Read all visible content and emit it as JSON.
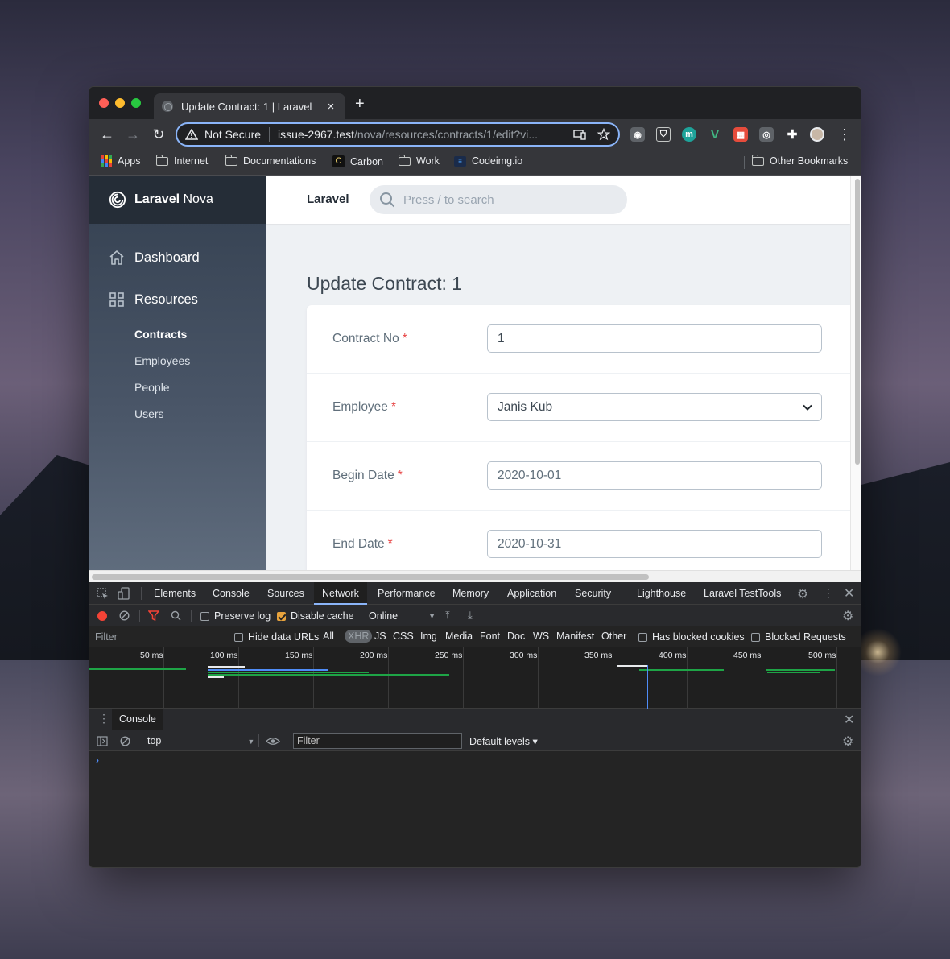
{
  "browser": {
    "tab_title": "Update Contract: 1 | Laravel",
    "tab_close": "×",
    "new_tab": "+",
    "security_label": "Not Secure",
    "url_host": "issue-2967.test",
    "url_path": "/nova/resources/contracts/1/edit?vi...",
    "nav": {
      "back": "←",
      "forward": "→",
      "reload": "↻",
      "menu": "⋮"
    },
    "bookmarks": [
      {
        "label": "Apps",
        "icon": "apps-grid-icon"
      },
      {
        "label": "Internet",
        "icon": "folder-icon"
      },
      {
        "label": "Documentations",
        "icon": "folder-icon"
      },
      {
        "label": "Carbon",
        "icon": "carbon-icon"
      },
      {
        "label": "Work",
        "icon": "folder-icon"
      },
      {
        "label": "Codeimg.io",
        "icon": "codeimg-icon"
      }
    ],
    "other_bookmarks": "Other Bookmarks",
    "extensions": [
      {
        "icon": "camera-icon",
        "glyph": "◉",
        "color": "#5f6368"
      },
      {
        "icon": "shield-icon",
        "glyph": "⛉",
        "color": "#35363a"
      },
      {
        "icon": "m-icon",
        "glyph": "m",
        "color": "#1ea39a"
      },
      {
        "icon": "vue-icon",
        "glyph": "V",
        "color": "#35363a"
      },
      {
        "icon": "laravel-icon",
        "glyph": "▦",
        "color": "#e64c3c"
      },
      {
        "icon": "bulb-icon",
        "glyph": "♀",
        "color": "#5f6368"
      },
      {
        "icon": "puzzle-icon",
        "glyph": "✚",
        "color": "#35363a"
      }
    ]
  },
  "nova": {
    "brand_bold": "Laravel",
    "brand_light": "Nova",
    "app_name": "Laravel",
    "search_placeholder": "Press / to search",
    "sidebar": {
      "dashboard": "Dashboard",
      "resources": "Resources",
      "items": [
        "Contracts",
        "Employees",
        "People",
        "Users"
      ]
    },
    "page_title": "Update Contract: 1",
    "required_mark": "*",
    "fields": [
      {
        "label": "Contract No",
        "value": "1",
        "type": "text"
      },
      {
        "label": "Employee",
        "value": "Janis Kub",
        "type": "select"
      },
      {
        "label": "Begin Date",
        "value": "2020-10-01",
        "type": "text"
      },
      {
        "label": "End Date",
        "value": "2020-10-31",
        "type": "text"
      }
    ]
  },
  "devtools": {
    "tabs": [
      "Elements",
      "Console",
      "Sources",
      "Network",
      "Performance",
      "Memory",
      "Application",
      "Security",
      "Lighthouse",
      "Laravel TestTools"
    ],
    "active_tab": "Network",
    "preserve_log": "Preserve log",
    "disable_cache": "Disable cache",
    "throttle": "Online",
    "filter_placeholder": "Filter",
    "hide_data_urls": "Hide data URLs",
    "type_filters": [
      "All",
      "XHR",
      "JS",
      "CSS",
      "Img",
      "Media",
      "Font",
      "Doc",
      "WS",
      "Manifest",
      "Other"
    ],
    "selected_type": "XHR",
    "has_blocked_cookies": "Has blocked cookies",
    "blocked_requests": "Blocked Requests",
    "timeline_labels": [
      "50 ms",
      "100 ms",
      "150 ms",
      "200 ms",
      "250 ms",
      "300 ms",
      "350 ms",
      "400 ms",
      "450 ms",
      "500 ms"
    ],
    "drawer_tab": "Console",
    "context": "top",
    "console_filter_placeholder": "Filter",
    "levels": "Default levels ▾",
    "prompt": "›"
  }
}
